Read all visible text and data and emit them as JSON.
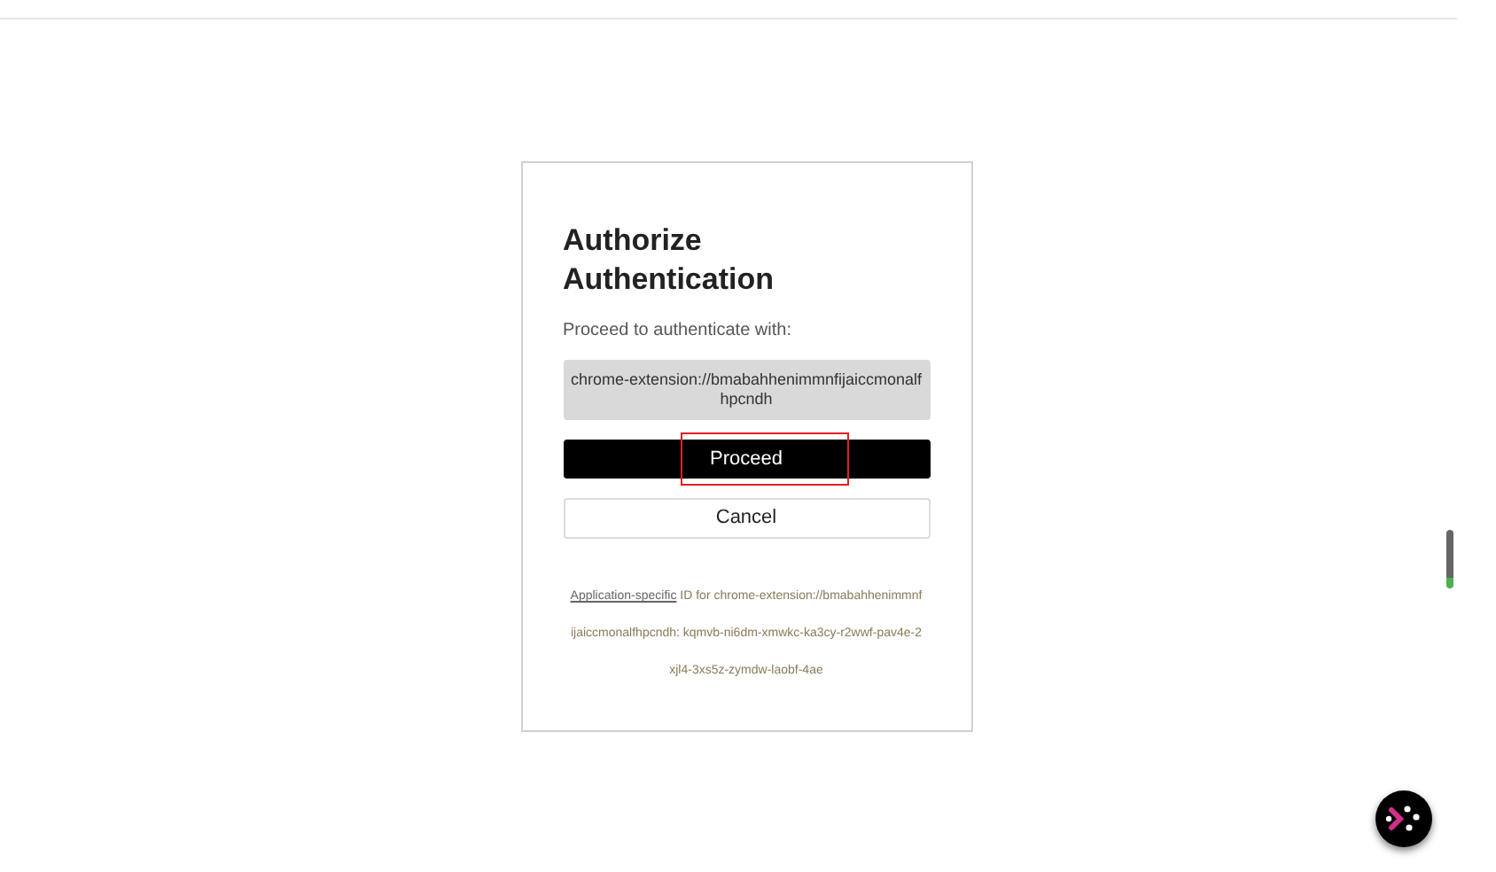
{
  "dialog": {
    "title": "Authorize Authentication",
    "prompt": "Proceed to authenticate with:",
    "origin": "chrome-extension://bmabahhenimmnfijaiccmonalfhpcndh",
    "buttons": [
      {
        "label": "Proceed",
        "kind": "primary",
        "highlighted": true
      },
      {
        "label": "Cancel",
        "kind": "secondary",
        "highlighted": false
      }
    ],
    "footer": {
      "link": "Application-specific",
      "text": "ID for chrome-extension://bmabahhenimmnfijaiccmonalfhpcndh: kqmvb-ni6dm-xmwkc-ka3cy-r2wwf-pav4e-2xjl4-3xs5z-zymdw-laobf-4ae"
    }
  }
}
